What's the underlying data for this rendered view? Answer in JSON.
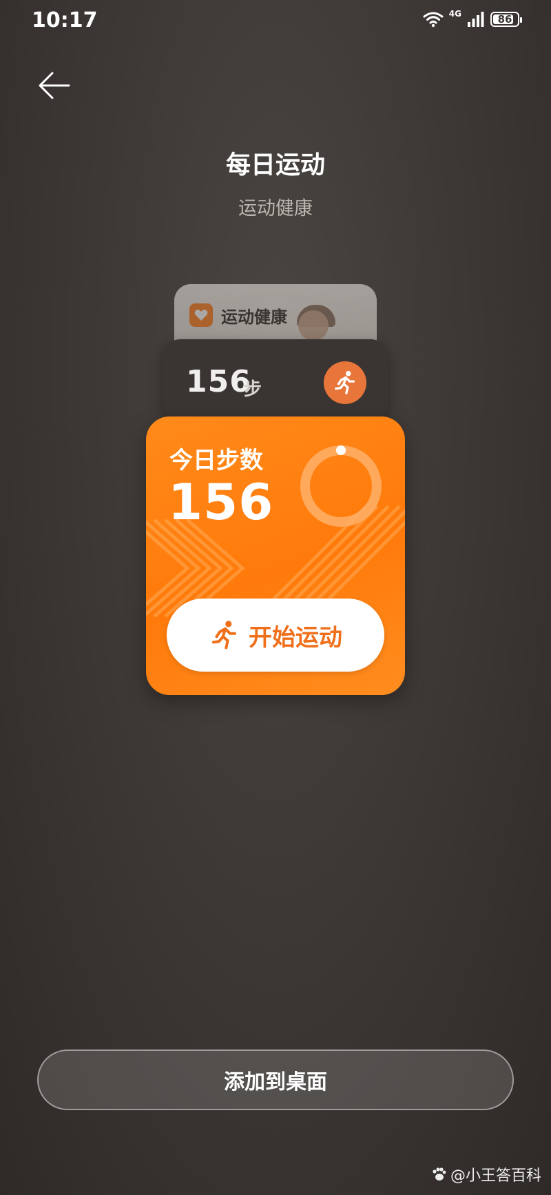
{
  "status_bar": {
    "time": "10:17",
    "network": "4G",
    "battery": "86",
    "battery_level": 0.86
  },
  "header": {
    "title": "每日运动",
    "subtitle": "运动健康"
  },
  "widget_stack": {
    "back_card": {
      "app_name": "运动健康"
    },
    "middle_card": {
      "steps": "156",
      "unit": "步"
    },
    "main_card": {
      "title": "今日步数",
      "steps": "156",
      "start_button_label": "开始运动",
      "accent_color": "#ff7a0a",
      "text_accent_color": "#f06f1a"
    }
  },
  "footer": {
    "add_button_label": "添加到桌面"
  },
  "watermark": {
    "text": "@小王答百科"
  },
  "icons": {
    "back": "arrow-left-icon",
    "wifi": "wifi-icon",
    "signal": "signal-icon",
    "battery": "battery-icon",
    "run": "running-person-icon",
    "app_logo": "heart-logo-icon",
    "watermark": "paw-icon"
  }
}
